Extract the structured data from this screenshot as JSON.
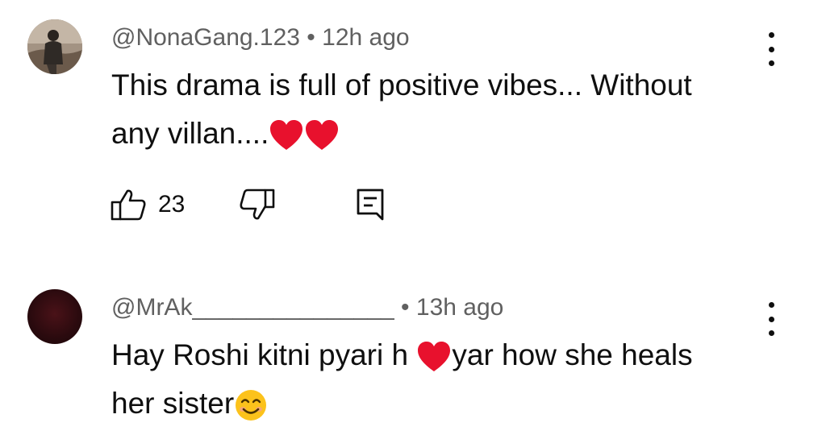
{
  "comments": [
    {
      "author": "@NonaGang.123",
      "time": "12h ago",
      "text_line1": "This drama is full of positive vibes... Without",
      "text_line2": "any villan....",
      "likes": "23",
      "avatar": "person-photo-avatar"
    },
    {
      "author": "@MrAk_______________",
      "time": "13h ago",
      "text_part1": "Hay Roshi kitni pyari h ",
      "text_part2": "yar how she heals",
      "text_line2": "her sister",
      "avatar": "dark-red-avatar"
    }
  ],
  "separator": " • ",
  "icons": {
    "like": "thumbs-up-icon",
    "dislike": "thumbs-down-icon",
    "reply": "reply-icon",
    "menu": "more-vert-icon",
    "heart": "red-heart-emoji",
    "smile": "smiling-face-emoji"
  },
  "colors": {
    "text": "#0f0f0f",
    "meta": "#606060",
    "heart": "#e8112d",
    "smile": "#fcc21b"
  }
}
